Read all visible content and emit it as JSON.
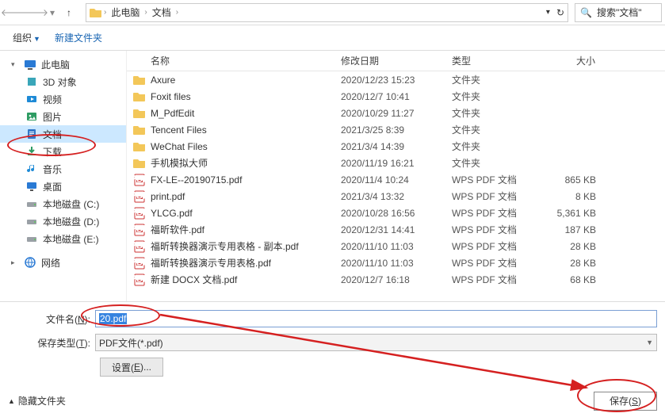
{
  "nav": {
    "up_label": "↑"
  },
  "breadcrumb": {
    "root_icon": "此电脑",
    "items": [
      "此电脑",
      "文档"
    ]
  },
  "search": {
    "placeholder": "搜索\"文档\""
  },
  "subbar": {
    "organize": "组织",
    "new_folder": "新建文件夹"
  },
  "sidebar": {
    "this_pc": "此电脑",
    "children": [
      {
        "label": "3D 对象",
        "icon": "3d"
      },
      {
        "label": "视频",
        "icon": "video"
      },
      {
        "label": "图片",
        "icon": "pictures"
      },
      {
        "label": "文档",
        "icon": "docs",
        "selected": true
      },
      {
        "label": "下载",
        "icon": "downloads"
      },
      {
        "label": "音乐",
        "icon": "music"
      },
      {
        "label": "桌面",
        "icon": "desktop"
      },
      {
        "label": "本地磁盘 (C:)",
        "icon": "drive"
      },
      {
        "label": "本地磁盘 (D:)",
        "icon": "drive"
      },
      {
        "label": "本地磁盘 (E:)",
        "icon": "drive"
      }
    ],
    "network": "网络"
  },
  "columns": {
    "name": "名称",
    "date": "修改日期",
    "type": "类型",
    "size": "大小"
  },
  "rows": [
    {
      "icon": "folder",
      "name": "Axure",
      "date": "2020/12/23 15:23",
      "type": "文件夹",
      "size": ""
    },
    {
      "icon": "folder",
      "name": "Foxit files",
      "date": "2020/12/7 10:41",
      "type": "文件夹",
      "size": ""
    },
    {
      "icon": "folder",
      "name": "M_PdfEdit",
      "date": "2020/10/29 11:27",
      "type": "文件夹",
      "size": ""
    },
    {
      "icon": "folder",
      "name": "Tencent Files",
      "date": "2021/3/25 8:39",
      "type": "文件夹",
      "size": ""
    },
    {
      "icon": "folder",
      "name": "WeChat Files",
      "date": "2021/3/4 14:39",
      "type": "文件夹",
      "size": ""
    },
    {
      "icon": "folder",
      "name": "手机模拟大师",
      "date": "2020/11/19 16:21",
      "type": "文件夹",
      "size": ""
    },
    {
      "icon": "pdf",
      "name": "FX-LE--20190715.pdf",
      "date": "2020/11/4 10:24",
      "type": "WPS PDF 文档",
      "size": "865 KB"
    },
    {
      "icon": "pdf",
      "name": "print.pdf",
      "date": "2021/3/4 13:32",
      "type": "WPS PDF 文档",
      "size": "8 KB"
    },
    {
      "icon": "pdf",
      "name": "YLCG.pdf",
      "date": "2020/10/28 16:56",
      "type": "WPS PDF 文档",
      "size": "5,361 KB"
    },
    {
      "icon": "pdf",
      "name": "福昕软件.pdf",
      "date": "2020/12/31 14:41",
      "type": "WPS PDF 文档",
      "size": "187 KB"
    },
    {
      "icon": "pdf",
      "name": "福昕转换器演示专用表格 - 副本.pdf",
      "date": "2020/11/10 11:03",
      "type": "WPS PDF 文档",
      "size": "28 KB"
    },
    {
      "icon": "pdf",
      "name": "福昕转换器演示专用表格.pdf",
      "date": "2020/11/10 11:03",
      "type": "WPS PDF 文档",
      "size": "28 KB"
    },
    {
      "icon": "pdf",
      "name": "新建 DOCX 文档.pdf",
      "date": "2020/12/7 16:18",
      "type": "WPS PDF 文档",
      "size": "68 KB"
    }
  ],
  "form": {
    "filename_label_pre": "文件名(",
    "filename_label_u": "N",
    "filename_label_post": "):",
    "filename_value": "20.pdf",
    "savetype_label_pre": "保存类型(",
    "savetype_label_u": "T",
    "savetype_label_post": "):",
    "savetype_value": "PDF文件(*.pdf)",
    "settings_btn_pre": "设置(",
    "settings_btn_u": "E",
    "settings_btn_post": ")..."
  },
  "footer": {
    "hide_folders": "隐藏文件夹",
    "save_pre": "保存(",
    "save_u": "S",
    "save_post": ")"
  }
}
